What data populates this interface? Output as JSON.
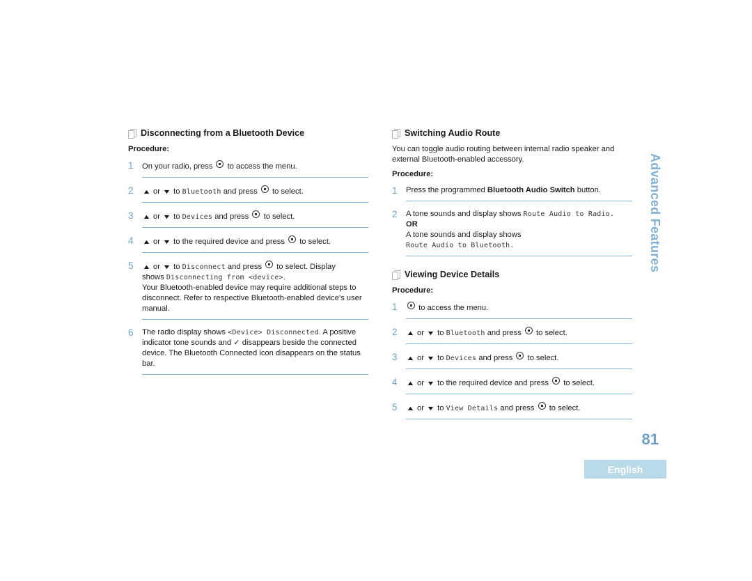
{
  "side_tab": "Advanced Features",
  "page_number": "81",
  "language": "English",
  "left": {
    "title": "Disconnecting from a Bluetooth Device",
    "procedure_label": "Procedure:",
    "steps": [
      {
        "num": "1",
        "pre": "On your radio, press",
        "post": "to access the menu."
      },
      {
        "num": "2",
        "or": "or",
        "to": "to",
        "mono": "Bluetooth",
        "mid": "and press",
        "post": "to select."
      },
      {
        "num": "3",
        "or": "or",
        "to": "to",
        "mono": "Devices",
        "mid": "and press",
        "post": "to select."
      },
      {
        "num": "4",
        "or": "or",
        "text": "to the required device and press",
        "post": "to select."
      },
      {
        "num": "5",
        "or": "or",
        "to": "to",
        "mono": "Disconnect",
        "mid": "and press",
        "post": "to select. Display",
        "shows": "shows",
        "mono2": "Disconnecting from <device>",
        "dot": ".",
        "extra": "Your Bluetooth-enabled device may require additional steps to disconnect. Refer to respective Bluetooth-enabled device's user manual."
      },
      {
        "num": "6",
        "pre": "The radio display shows",
        "mono": "<Device> Disconnected",
        "post": ". A positive indicator tone sounds and ✓ disappears beside the connected device. The Bluetooth Connected icon disappears on the status bar."
      }
    ]
  },
  "right": {
    "title": "Switching Audio Route",
    "intro": "You can toggle audio routing between internal radio speaker and external Bluetooth-enabled accessory.",
    "procedure_label": "Procedure:",
    "steps": [
      {
        "num": "1",
        "pre": "Press the programmed",
        "bold": "Bluetooth Audio Switch",
        "post": "button."
      },
      {
        "num": "2",
        "pre": "A tone sounds and display shows",
        "mono": "Route Audio to Radio.",
        "or_label": "OR",
        "pre2": "A tone sounds and display shows",
        "mono2": "Route Audio to Bluetooth."
      }
    ],
    "section2": {
      "title": "Viewing Device Details",
      "procedure_label": "Procedure:",
      "steps": [
        {
          "num": "1",
          "post": "to access the menu."
        },
        {
          "num": "2",
          "or": "or",
          "to": "to",
          "mono": "Bluetooth",
          "mid": "and press",
          "post": "to select."
        },
        {
          "num": "3",
          "or": "or",
          "to": "to",
          "mono": "Devices",
          "mid": "and press",
          "post": "to select."
        },
        {
          "num": "4",
          "or": "or",
          "text": "to the required device and press",
          "post": "to select."
        },
        {
          "num": "5",
          "or": "or",
          "to": "to",
          "mono": "View Details",
          "mid": "and press",
          "post": "to select."
        }
      ]
    }
  },
  "icons": {
    "up": "▲",
    "down": "▼"
  }
}
